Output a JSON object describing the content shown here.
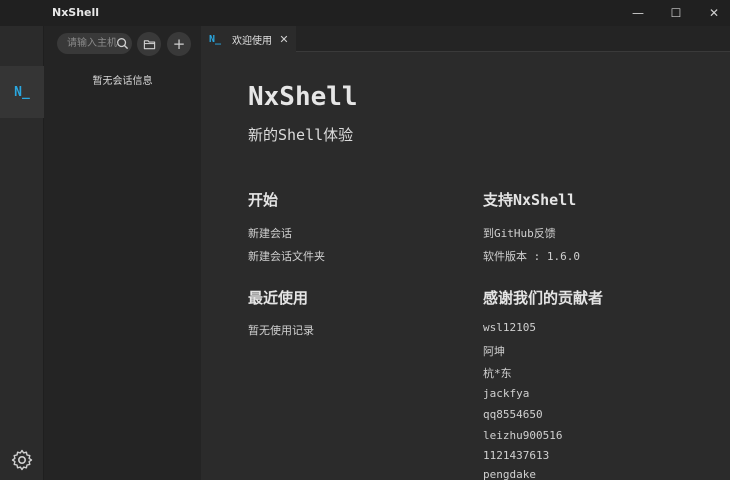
{
  "window": {
    "title": "NxShell",
    "minimize": "—",
    "maximize": "☐",
    "close": "✕"
  },
  "activity": {
    "terminal_label": "N_"
  },
  "sidebar": {
    "search_placeholder": "请输入主机",
    "empty_text": "暂无会话信息",
    "add_label": "+"
  },
  "tabs": [
    {
      "icon": "N_",
      "label": "欢迎使用",
      "close": "✕"
    }
  ],
  "welcome": {
    "title": "NxShell",
    "subtitle": "新的Shell体验",
    "start": {
      "heading": "开始",
      "new_session": "新建会话",
      "new_folder": "新建会话文件夹"
    },
    "recent": {
      "heading": "最近使用",
      "empty": "暂无使用记录"
    },
    "support": {
      "heading": "支持NxShell",
      "feedback": "到GitHub反馈",
      "version_label": "软件版本 : 1.6.0"
    },
    "thanks": {
      "heading": "感谢我们的贡献者",
      "contributors": [
        "wsl12105",
        "阿坤",
        "杭*东",
        "jackfya",
        "qq8554650",
        "leizhu900516",
        "1121437613",
        "pengdake"
      ]
    }
  },
  "colors": {
    "accent": "#2aa7e0",
    "background": "#2b2b2b",
    "sidebar": "#242424",
    "titlebar": "#202020"
  }
}
